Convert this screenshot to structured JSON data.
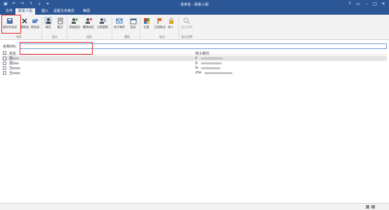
{
  "window": {
    "title": "未命名 - 联系人组"
  },
  "qat": [
    "save-icon",
    "undo-icon",
    "redo-icon",
    "up-icon",
    "down-icon",
    "more-icon"
  ],
  "tabs": [
    {
      "label": "文件"
    },
    {
      "label": "联系人组"
    },
    {
      "label": "插入"
    },
    {
      "label": "设置文本格式"
    },
    {
      "label": "审阅"
    }
  ],
  "ribbon": {
    "buttons": [
      {
        "label": "保存并关闭",
        "icon": "save-close-icon"
      },
      {
        "label": "删除组",
        "icon": "delete-group-icon"
      },
      {
        "label": "转发组",
        "icon": "forward-group-icon"
      },
      {
        "label": "成员",
        "icon": "members-icon"
      },
      {
        "label": "备注",
        "icon": "notes-icon"
      },
      {
        "label": "添加成员",
        "icon": "add-member-icon"
      },
      {
        "label": "删除成员",
        "icon": "remove-member-icon"
      },
      {
        "label": "立即更新",
        "icon": "update-now-icon"
      },
      {
        "label": "电子邮件",
        "icon": "email-icon"
      },
      {
        "label": "会议",
        "icon": "meeting-icon"
      },
      {
        "label": "分类",
        "icon": "categorize-icon"
      },
      {
        "label": "后续标志",
        "icon": "follow-up-icon"
      },
      {
        "label": "私人",
        "icon": "private-icon"
      },
      {
        "label": "显示比例",
        "icon": "zoom-icon"
      }
    ],
    "groups": [
      "动作",
      "显示",
      "成员",
      "通信",
      "标记",
      "显示比例"
    ]
  },
  "name_field": {
    "label": "名称(M):",
    "value": ""
  },
  "table": {
    "columns": [
      "姓名",
      "电子邮件"
    ],
    "rows": [
      {
        "name": "郭",
        "email": "y"
      },
      {
        "name": "郭",
        "email": "g"
      },
      {
        "name": "王",
        "email": "w"
      },
      {
        "name": "王",
        "email": "zhe"
      }
    ]
  }
}
